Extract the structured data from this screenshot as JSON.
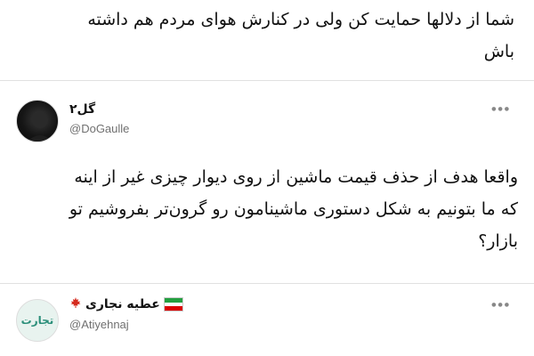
{
  "previous_tweet": {
    "line1": "شما از دلالها حمایت کن ولی در کنارش هوای مردم هم داشته",
    "line2": "باش"
  },
  "tweet1": {
    "display_name": "۲گل",
    "handle": "@DoGaulle",
    "more_icon": "more-horizontal-icon",
    "lines": [
      "واقعا هدف از حذف قیمت ماشین از روی دیوار چیزی غیر از اینه",
      "که ما بتونیم به شکل دستوری ماشینامون رو گرون‌تر بفروشیم تو",
      "بازار؟"
    ]
  },
  "tweet2": {
    "display_name": "عطیه نجاری",
    "handle": "@Atiyehnaj",
    "avatar_text": "تجارت",
    "more_icon": "more-horizontal-icon",
    "badges": [
      "iran-flag-icon",
      "maple-leaf-icon"
    ]
  },
  "colors": {
    "flag_green": "#239f40",
    "flag_white": "#ffffff",
    "flag_red": "#da0000",
    "maple_red": "#d52b1e",
    "handle_gray": "#707070"
  }
}
